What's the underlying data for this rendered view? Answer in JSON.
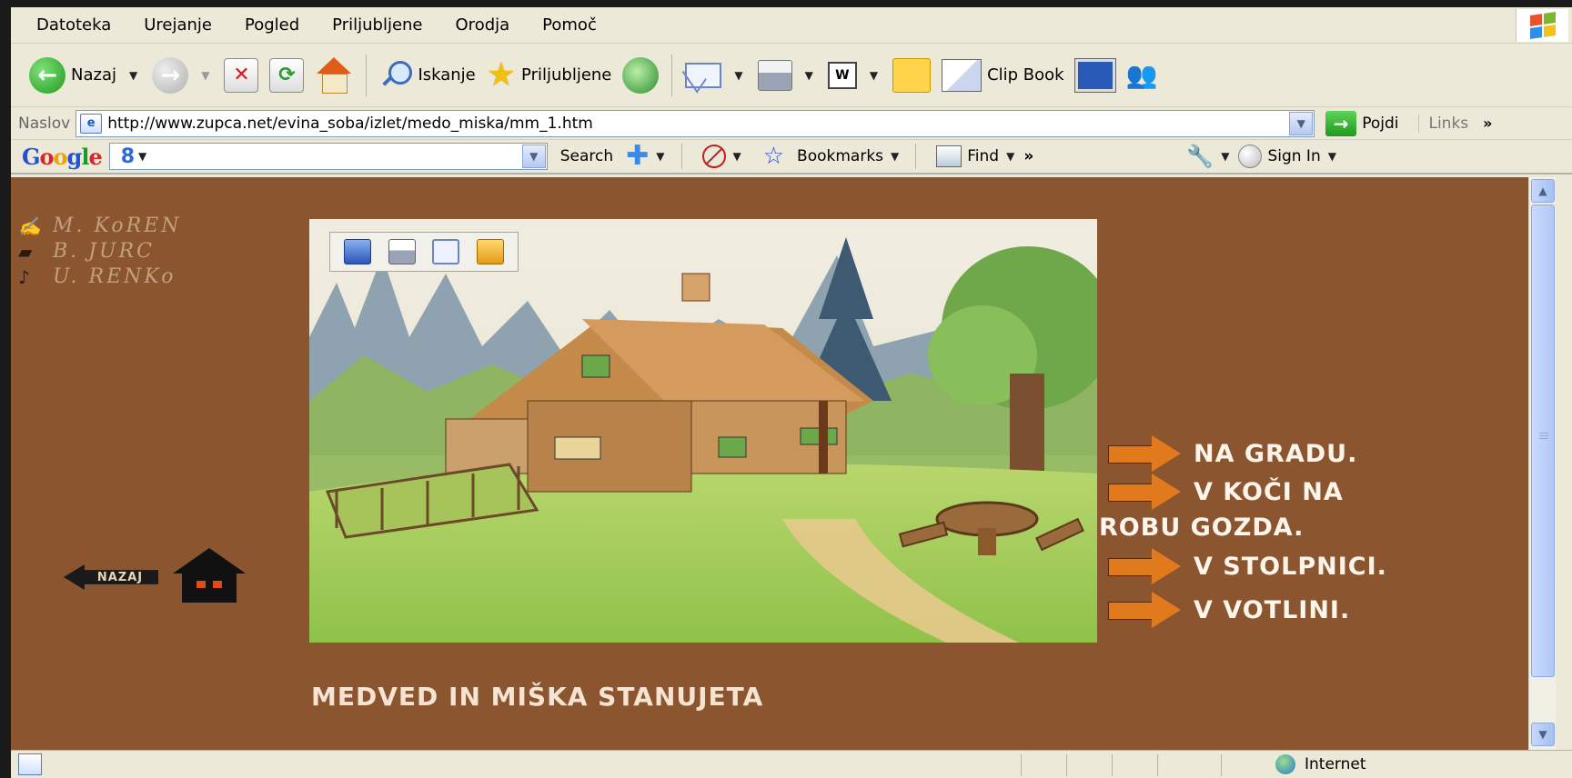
{
  "menu": [
    "Datoteka",
    "Urejanje",
    "Pogled",
    "Priljubljene",
    "Orodja",
    "Pomoč"
  ],
  "toolbar": {
    "back_label": "Nazaj",
    "search_label": "Iskanje",
    "favorites_label": "Priljubljene",
    "clipbook_label": "Clip Book"
  },
  "address": {
    "label": "Naslov",
    "url": "http://www.zupca.net/evina_soba/izlet/medo_miska/mm_1.htm",
    "go_label": "Pojdi",
    "links_label": "Links",
    "more": "»"
  },
  "googlebar": {
    "logo": [
      "G",
      "o",
      "o",
      "g",
      "l",
      "e"
    ],
    "g8": "8",
    "search_label": "Search",
    "bookmarks_label": "Bookmarks",
    "find_label": "Find",
    "more": "»",
    "signin_label": "Sign In"
  },
  "page": {
    "credits": [
      "M. KoREN",
      "B. JURC",
      "U. RENKo"
    ],
    "answers": [
      {
        "text": "NA GRADU."
      },
      {
        "text": "V KOČI NA",
        "text2": "ROBU GOZDA."
      },
      {
        "text": "V STOLPNICI."
      },
      {
        "text": "V VOTLINI."
      }
    ],
    "title": "MEDVED IN MIŠKA STANUJETA",
    "back_link": "NAZAJ"
  },
  "status": {
    "zone": "Internet"
  },
  "colors": {
    "page_bg": "#8b5530",
    "arrow": "#e07a1c",
    "text_light": "#fff5ea"
  }
}
